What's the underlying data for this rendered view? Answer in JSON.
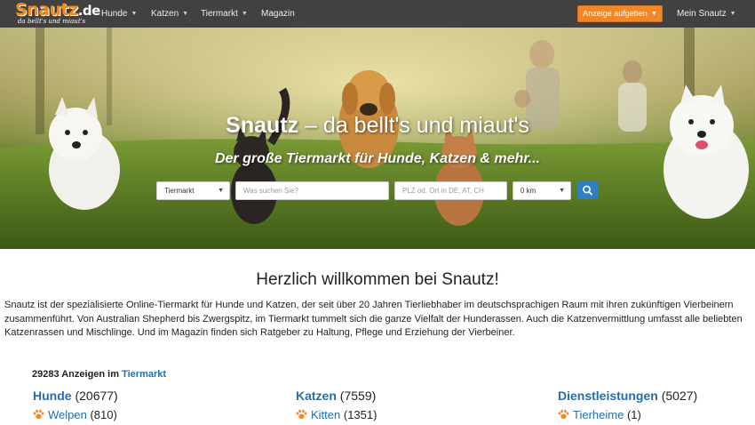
{
  "brand": {
    "name": "Snautz",
    "tld": ".de",
    "tagline": "da bellt's und miaut's"
  },
  "nav": {
    "items": [
      {
        "label": "Hunde",
        "dropdown": true
      },
      {
        "label": "Katzen",
        "dropdown": true
      },
      {
        "label": "Tiermarkt",
        "dropdown": true
      },
      {
        "label": "Magazin",
        "dropdown": false
      }
    ],
    "cta_label": "Anzeige aufgeben",
    "account_label": "Mein Snautz"
  },
  "hero": {
    "title_brand": "Snautz",
    "title_rest": " – da bellt's und miaut's",
    "subtitle": "Der große Tiermarkt für Hunde, Katzen & mehr...",
    "search": {
      "category_value": "Tiermarkt",
      "query_placeholder": "Was suchen Sie?",
      "location_placeholder": "PLZ od. Ort in DE, AT, CH",
      "radius_value": "0 km"
    }
  },
  "content": {
    "welcome_heading": "Herzlich willkommen bei Snautz!",
    "intro_text": "Snautz ist der spezialisierte Online-Tiermarkt für Hunde und Katzen, der seit über 20 Jahren Tierliebhaber im deutschsprachigen Raum mit ihren zukünftigen Vierbeinern zusammenführt. Von Australian Shepherd bis Zwergspitz, im Tiermarkt tummelt sich die ganze Vielfalt der Hunderassen. Auch die Katzenvermittlung umfasst alle beliebten Katzenrassen und Mischlinge. Und im Magazin finden sich Ratgeber zu Haltung, Pflege und Erziehung der Vierbeiner.",
    "listing_count_text": "29283 Anzeigen im",
    "listing_count_link": "Tiermarkt",
    "categories": [
      {
        "name": "Hunde",
        "count": "(20677)",
        "sub_name": "Welpen",
        "sub_count": "(810)"
      },
      {
        "name": "Katzen",
        "count": "(7559)",
        "sub_name": "Kitten",
        "sub_count": "(1351)"
      },
      {
        "name": "Dienstleistungen",
        "count": "(5027)",
        "sub_name": "Tierheime",
        "sub_count": "(1)"
      }
    ]
  },
  "colors": {
    "navbar": "#414141",
    "accent_orange": "#f0882a",
    "link_blue": "#1f6fb5",
    "search_button": "#2f7fc3"
  },
  "icons": {
    "search": "search-icon",
    "paw": "paw-icon",
    "caret": "chevron-down-icon"
  }
}
